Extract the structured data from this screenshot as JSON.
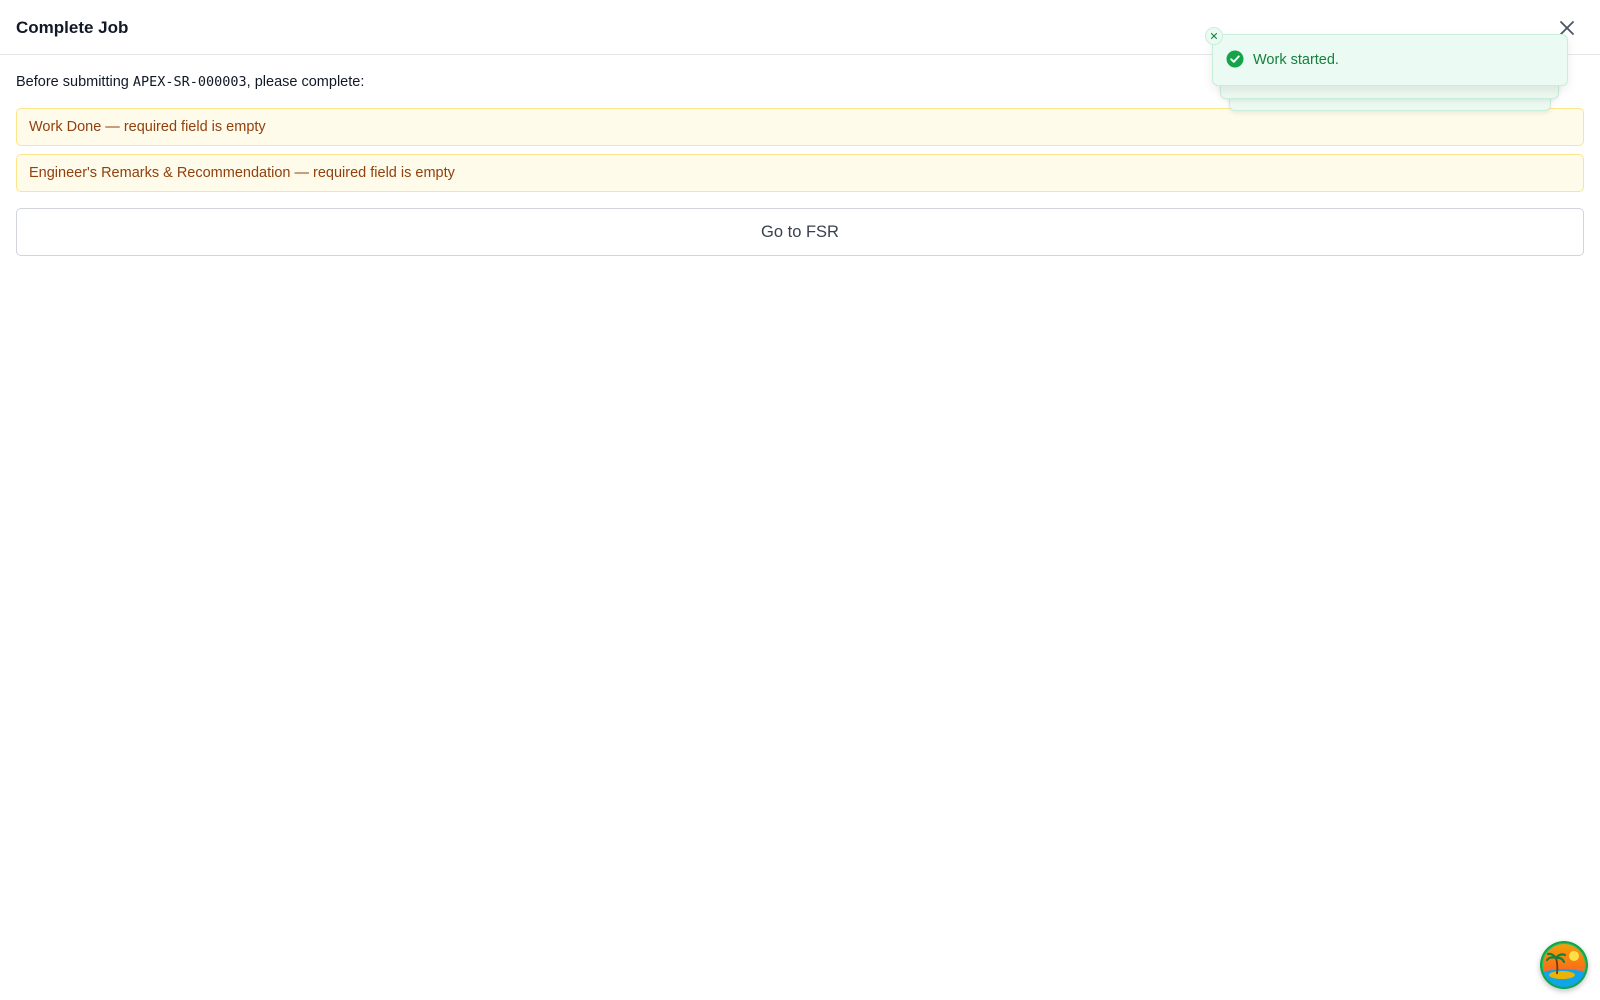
{
  "dialog": {
    "title": "Complete Job",
    "close_icon": "close-icon"
  },
  "intro": {
    "prefix": "Before submitting ",
    "code": "APEX-SR-000003",
    "suffix": ", please complete:"
  },
  "missing_items": [
    {
      "label": "Work Done — required field is empty"
    },
    {
      "label": "Engineer's Remarks & Recommendation — required field is empty"
    }
  ],
  "actions": {
    "go_to_fsr": "Go to FSR"
  },
  "toast": {
    "message": "Work started.",
    "icon": "check-circle-icon",
    "close_icon": "close-icon",
    "stacked_count": 3
  },
  "avatar": {
    "icon": "island-avatar-icon"
  },
  "colors": {
    "warning_bg": "#fefbea",
    "warning_border": "#fde58a",
    "warning_text": "#92400e",
    "toast_bg": "#ebfaf2",
    "toast_text": "#15803d",
    "toast_icon": "#16a34a"
  }
}
